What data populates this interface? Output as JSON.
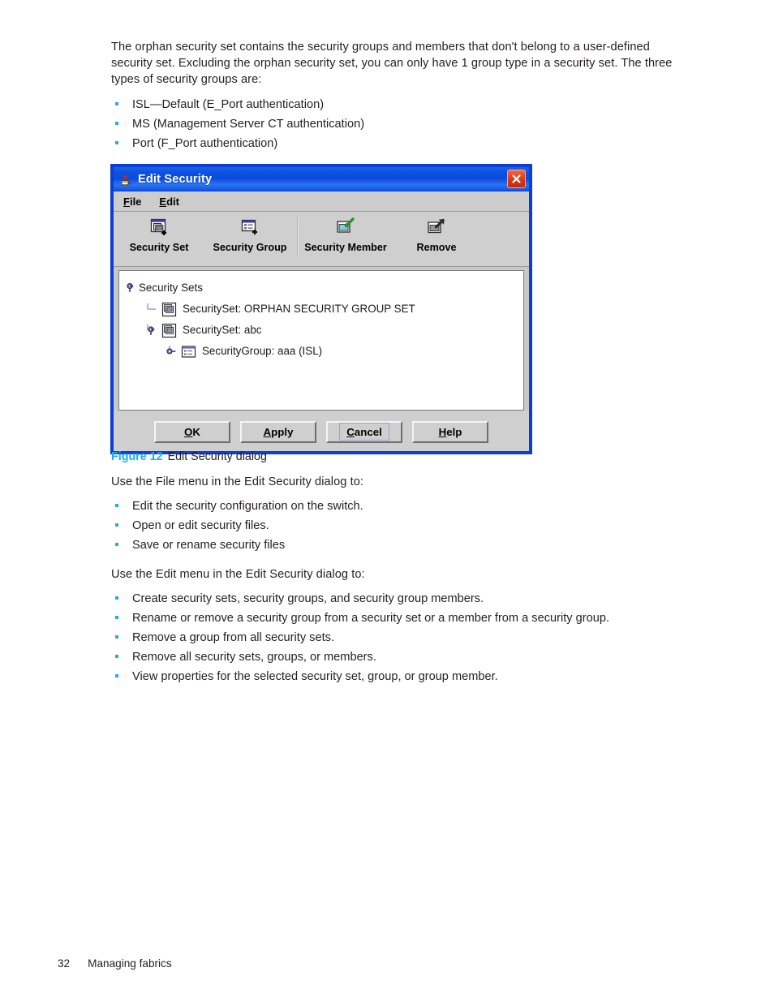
{
  "document": {
    "intro_paragraph": "The orphan security set contains the security groups and members that don't belong to a user-defined security set. Excluding the orphan security set, you can only have 1 group type in a security set. The three types of security groups are:",
    "group_types": [
      "ISL—Default (E_Port authentication)",
      "MS (Management Server CT authentication)",
      "Port (F_Port authentication)"
    ],
    "figure": {
      "number": "Figure 12",
      "caption": "Edit Security dialog"
    },
    "file_menu_intro": "Use the File menu in the Edit Security dialog to:",
    "file_menu_items": [
      "Edit the security configuration on the switch.",
      "Open or edit security files.",
      "Save or rename security files"
    ],
    "edit_menu_intro": "Use the Edit menu in the Edit Security dialog to:",
    "edit_menu_items": [
      "Create security sets, security groups, and security group members.",
      "Rename or remove a security group from a security set or a member from a security group.",
      "Remove a group from all security sets.",
      "Remove all security sets, groups, or members.",
      "View properties for the selected security set, group, or group member."
    ],
    "footer": {
      "page_number": "32",
      "section": "Managing fabrics"
    }
  },
  "dialog": {
    "title": "Edit Security",
    "app_icon": "java-coffee-cup-icon",
    "close_icon": "close-icon",
    "menubar": [
      {
        "label": "Edit Security File menu",
        "text": "File",
        "mnemonic": "F",
        "rest": "ile"
      },
      {
        "label": "Edit Security Edit menu",
        "text": "Edit",
        "mnemonic": "E",
        "rest": "dit"
      }
    ],
    "toolbar": [
      {
        "label": "Security Set",
        "icon": "security-set-add-icon"
      },
      {
        "label": "Security Group",
        "icon": "security-group-add-icon"
      },
      {
        "label": "Security Member",
        "icon": "security-member-add-icon"
      },
      {
        "label": "Remove",
        "icon": "remove-icon"
      }
    ],
    "tree": {
      "root": {
        "label": "Security Sets",
        "handle": "expanded",
        "icon": "none"
      },
      "nodes": [
        {
          "label": "SecuritySet: ORPHAN SECURITY GROUP SET",
          "handle": "leaf",
          "icon": "security-set-icon",
          "indent": 2
        },
        {
          "label": "SecuritySet: abc",
          "handle": "expanded",
          "icon": "security-set-icon",
          "indent": 2
        },
        {
          "label": "SecurityGroup: aaa (ISL)",
          "handle": "collapsed",
          "icon": "security-group-icon",
          "indent": 3
        }
      ]
    },
    "buttons": [
      {
        "text": "OK",
        "mnemonic": "O",
        "pre": "",
        "post": "K",
        "focused": false
      },
      {
        "text": "Apply",
        "mnemonic": "A",
        "pre": "",
        "post": "pply",
        "focused": false
      },
      {
        "text": "Cancel",
        "mnemonic": "C",
        "pre": "",
        "post": "ancel",
        "focused": true
      },
      {
        "text": "Help",
        "mnemonic": "H",
        "pre": "",
        "post": "elp",
        "focused": false
      }
    ]
  },
  "colors": {
    "titlebar_blue": "#0d53e2",
    "dialog_border": "#0b3fd4",
    "close_red": "#e23a17",
    "figure_accent": "#19b0e8",
    "bullet_blue": "#2ba9e0",
    "panel_gray": "#cfcfcf"
  }
}
